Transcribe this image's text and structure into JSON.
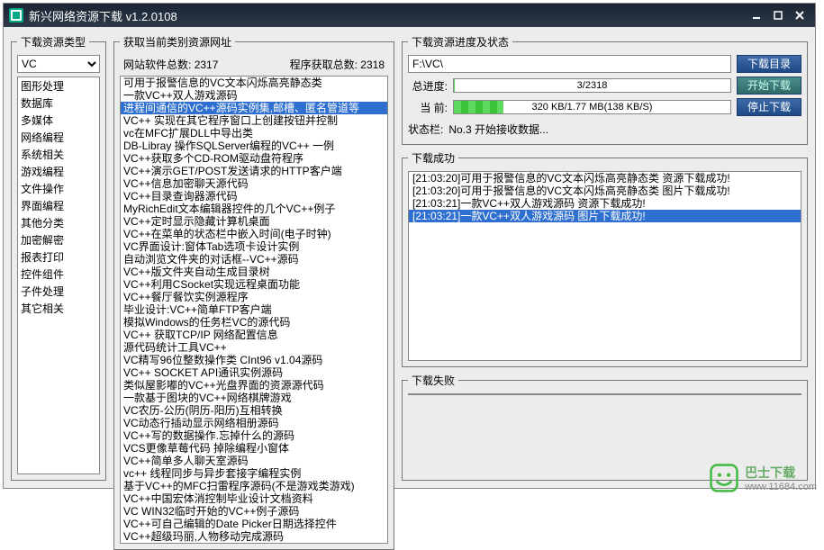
{
  "window": {
    "title": "新兴网络资源下载  v1.2.0108"
  },
  "col1": {
    "legend": "下载资源类型",
    "select_value": "VC",
    "categories": [
      "图形处理",
      "数据库",
      "多媒体",
      "网络编程",
      "系统相关",
      "游戏编程",
      "文件操作",
      "界面编程",
      "其他分类",
      "加密解密",
      "报表打印",
      "控件组件",
      "子件处理",
      "其它相关"
    ]
  },
  "col2": {
    "legend": "获取当前类别资源网址",
    "site_count_label": "网站软件总数:",
    "site_count": "2317",
    "prog_count_label": "程序获取总数:",
    "prog_count": "2318",
    "items": [
      "可用于报警信息的VC文本闪烁高亮静态类",
      "一款VC++双人游戏源码",
      "进程间通信的VC++源码实例集,邮槽、匿名管道等",
      "VC++ 实现在其它程序窗口上创建按钮并控制",
      "vc在MFC扩展DLL中导出类",
      "DB-Libray 操作SQLServer编程的VC++ 一例",
      "VC++获取多个CD-ROM驱动盘符程序",
      "VC++演示GET/POST发送请求的HTTP客户端",
      "VC++信息加密聊天源代码",
      "VC++目录查询器源代码",
      "MyRichEdit文本编辑器控件的几个VC++例子",
      "VC++定时显示隐藏计算机桌面",
      "VC++在菜单的状态栏中嵌入时间(电子时钟)",
      "VC界面设计:窗体Tab选项卡设计实例",
      "自动浏览文件夹的对话框--VC++源码",
      "VC++版文件夹自动生成目录树",
      "VC++利用CSocket实现远程桌面功能",
      "VC++餐厅餐饮实例源程序",
      "毕业设计:VC++简单FTP客户端",
      "模拟Windows的任务栏VC的源代码",
      "VC++ 获取TCP/IP 网络配置信息",
      "源代码统计工具VC++",
      "VC精写96位整数操作类 CInt96 v1.04源码",
      "VC++ SOCKET API通讯实例源码",
      "类似屋影嘟的VC++光盘界面的资源源代码",
      "一款基于图块的VC++网络棋牌游戏",
      "VC农历-公历(阴历-阳历)互相转换",
      "VC动态行插动显示网络相册源码",
      "VC++写的数据操作.忘掉什么的源码",
      "VCS更像草莓代码 掉除编程小窗体",
      "VC++简单多人聊天室源码",
      "vc++ 线程同步与异步套接字编程实例",
      "基于VC++的MFC扫雷程序源码(不是游戏类游戏)",
      "VC++中国宏体消控制毕业设计文档资料",
      "VC WIN32临时开始的VC++例子源码",
      "VC++可自己编辑的Date Picker日期选择控件",
      "VC++超级玛丽,人物移动完成源码"
    ],
    "selected_index": 2
  },
  "col3": {
    "legend_progress": "下载资源进度及状态",
    "path": "F:\\VC\\",
    "btn_browse": "下载目录",
    "btn_start": "开始下载",
    "btn_stop": "停止下载",
    "label_total": "总进度:",
    "total_text": "3/2318",
    "total_pct": 0.2,
    "label_cur": "当  前:",
    "cur_text": "320 KB/1.77 MB(138 KB/S)",
    "cur_pct": 18,
    "label_status": "状态栏:",
    "status_text": "No.3 开始接收数据...",
    "legend_success": "下载成功",
    "success_items": [
      "[21:03:20]可用于报警信息的VC文本闪烁高亮静态类 资源下载成功!",
      "[21:03:20]可用于报警信息的VC文本闪烁高亮静态类 图片下载成功!",
      "[21:03:21]一款VC++双人游戏源码 资源下载成功!",
      "[21:03:21]一款VC++双人游戏源码 图片下载成功!"
    ],
    "success_selected": 3,
    "legend_fail": "下载失败"
  },
  "watermark": {
    "name": "巴士下载",
    "url": "www.11684.com"
  }
}
